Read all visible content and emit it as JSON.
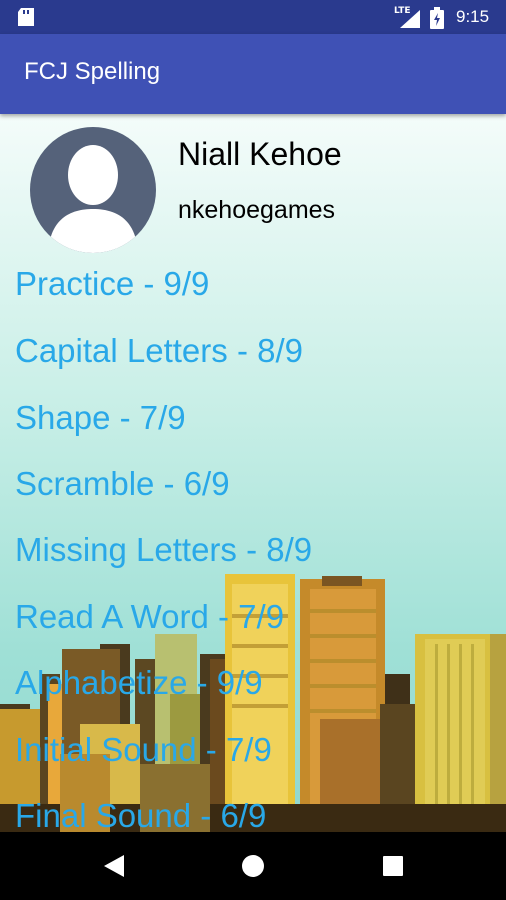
{
  "status": {
    "time": "9:15",
    "network": "LTE"
  },
  "app": {
    "title": "FCJ Spelling"
  },
  "profile": {
    "name": "Niall Kehoe",
    "username": "nkehoegames"
  },
  "menu": [
    {
      "label": "Practice - 9/9"
    },
    {
      "label": "Capital Letters - 8/9"
    },
    {
      "label": "Shape - 7/9"
    },
    {
      "label": "Scramble - 6/9"
    },
    {
      "label": "Missing Letters - 8/9"
    },
    {
      "label": "Read A Word - 7/9"
    },
    {
      "label": "Alphabetize - 9/9"
    },
    {
      "label": "Initial Sound - 7/9"
    },
    {
      "label": "Final Sound - 6/9"
    }
  ],
  "colors": {
    "app_bar": "#3f51b5",
    "status_bar": "#2a3a8e",
    "menu_text": "#29a8e8"
  }
}
